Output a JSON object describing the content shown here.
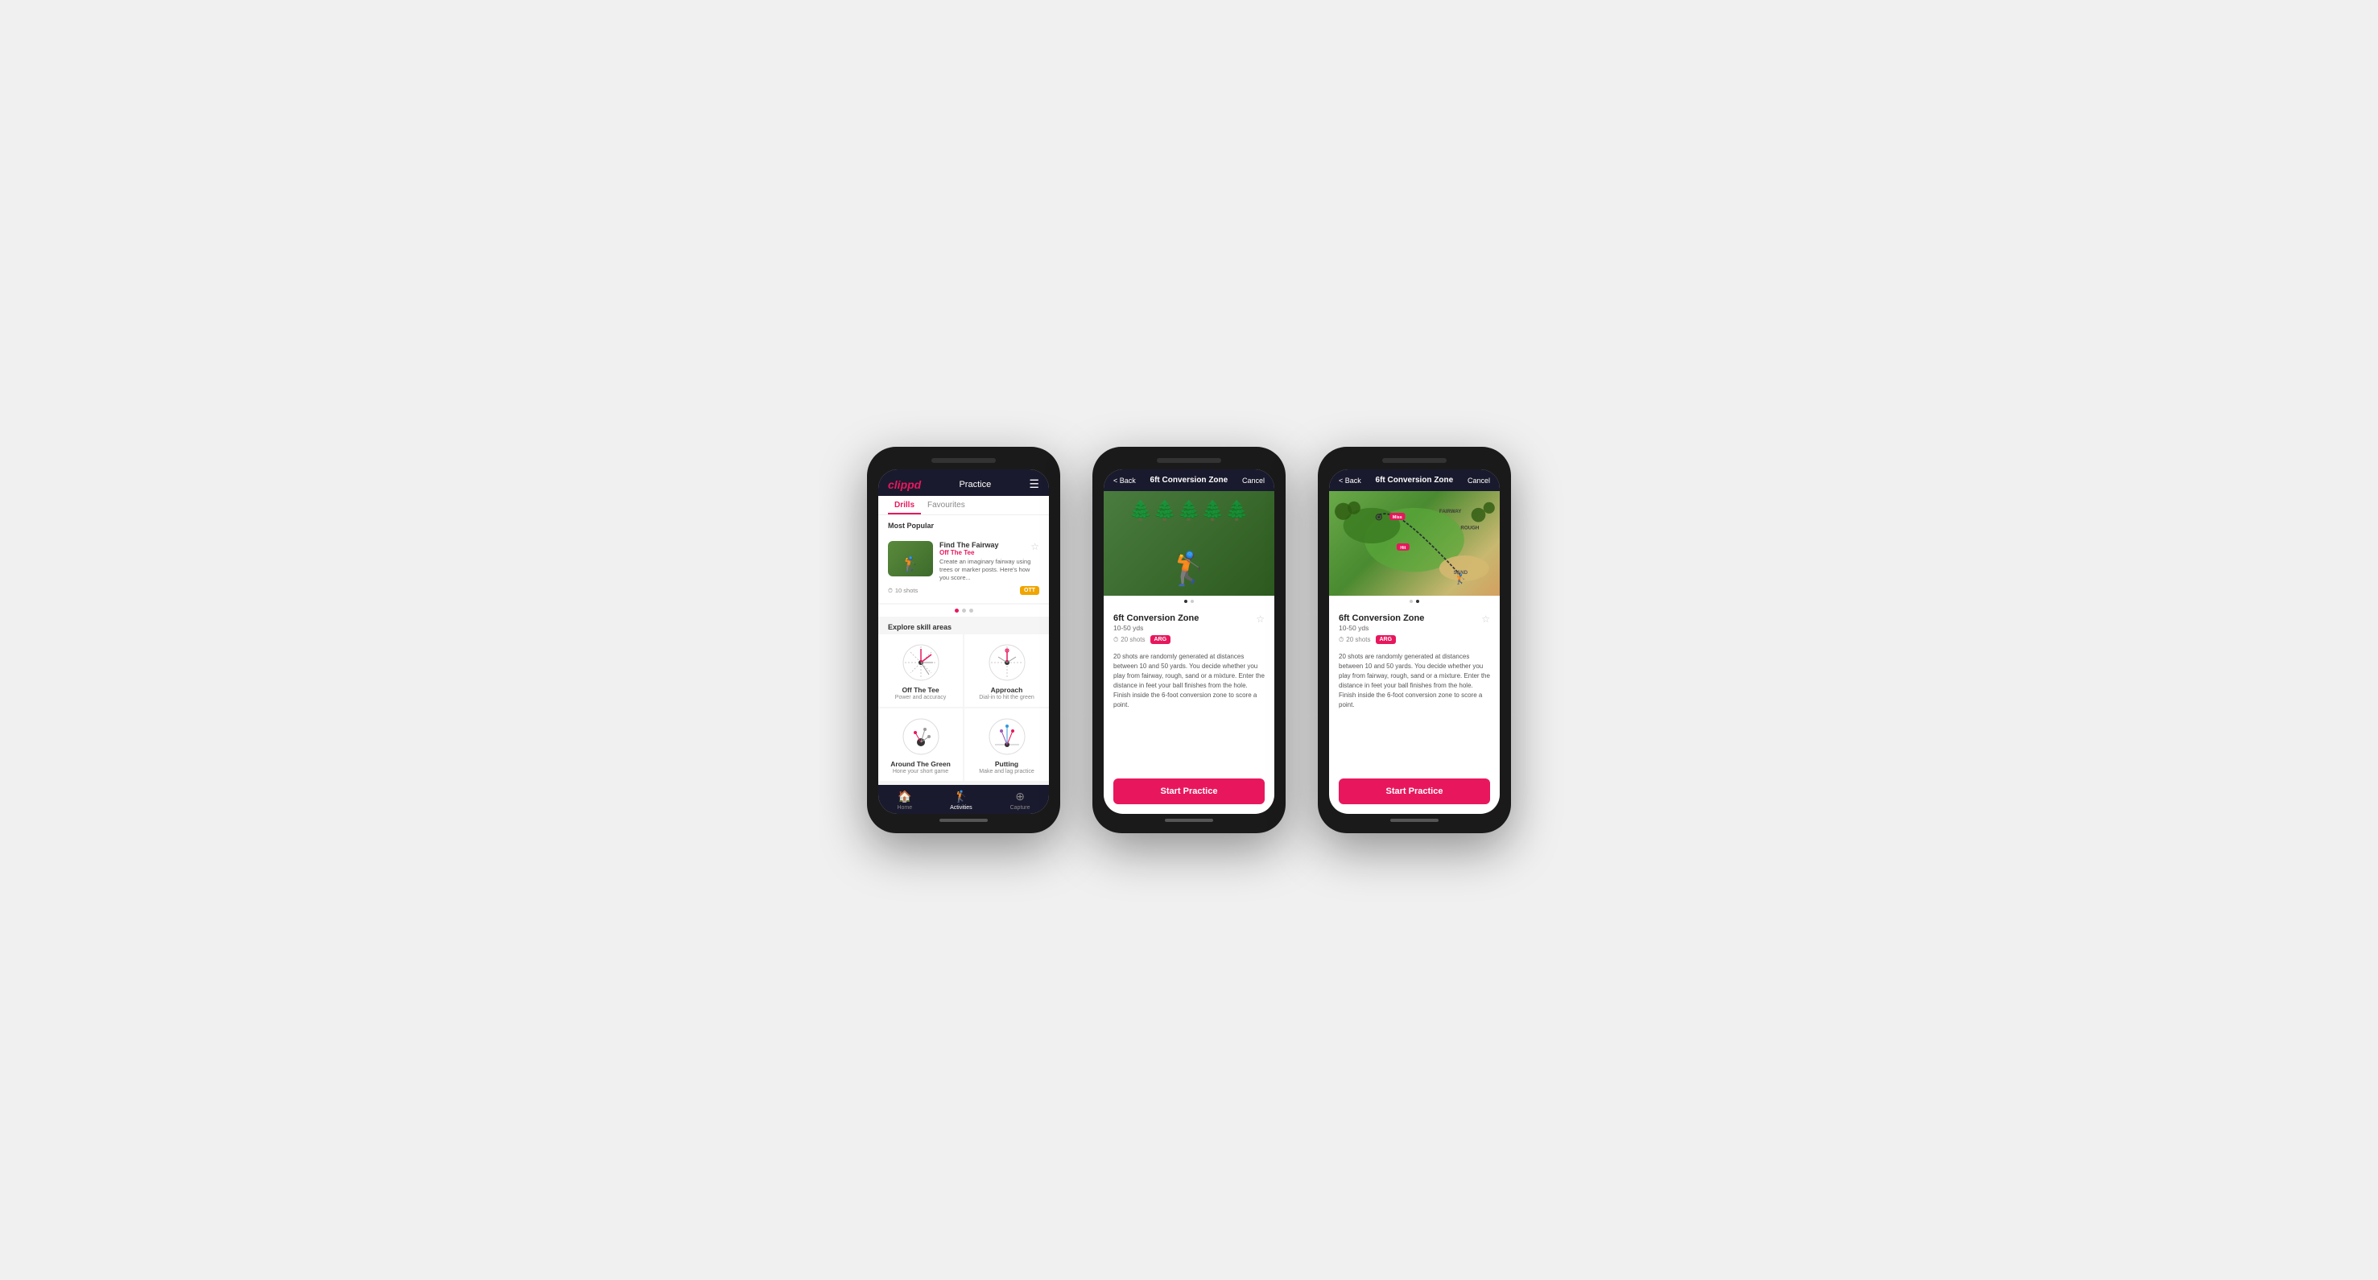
{
  "phones": [
    {
      "id": "phone1",
      "header": {
        "logo": "clippd",
        "title": "Practice",
        "menu_icon": "☰"
      },
      "tabs": [
        {
          "label": "Drills",
          "active": true
        },
        {
          "label": "Favourites",
          "active": false
        }
      ],
      "most_popular_label": "Most Popular",
      "drill_card": {
        "title": "Find The Fairway",
        "subtitle": "Off The Tee",
        "description": "Create an imaginary fairway using trees or marker posts. Here's how you score...",
        "shots": "10 shots",
        "badge": "OTT",
        "star": "☆"
      },
      "explore_label": "Explore skill areas",
      "skill_areas": [
        {
          "name": "Off The Tee",
          "desc": "Power and accuracy"
        },
        {
          "name": "Approach",
          "desc": "Dial-in to hit the green"
        },
        {
          "name": "Around The Green",
          "desc": "Hone your short game"
        },
        {
          "name": "Putting",
          "desc": "Make and lag practice"
        }
      ],
      "nav": [
        {
          "icon": "🏠",
          "label": "Home",
          "active": false
        },
        {
          "icon": "🏌",
          "label": "Activities",
          "active": true
        },
        {
          "icon": "⊕",
          "label": "Capture",
          "active": false
        }
      ]
    },
    {
      "id": "phone2",
      "header": {
        "back_label": "< Back",
        "title": "6ft Conversion Zone",
        "cancel_label": "Cancel"
      },
      "image_type": "photo",
      "drill": {
        "name": "6ft Conversion Zone",
        "range": "10-50 yds",
        "shots": "20 shots",
        "badge": "ARG",
        "star": "☆",
        "description": "20 shots are randomly generated at distances between 10 and 50 yards. You decide whether you play from fairway, rough, sand or a mixture. Enter the distance in feet your ball finishes from the hole. Finish inside the 6-foot conversion zone to score a point."
      },
      "start_button": "Start Practice"
    },
    {
      "id": "phone3",
      "header": {
        "back_label": "< Back",
        "title": "6ft Conversion Zone",
        "cancel_label": "Cancel"
      },
      "image_type": "map",
      "drill": {
        "name": "6ft Conversion Zone",
        "range": "10-50 yds",
        "shots": "20 shots",
        "badge": "ARG",
        "star": "☆",
        "description": "20 shots are randomly generated at distances between 10 and 50 yards. You decide whether you play from fairway, rough, sand or a mixture. Enter the distance in feet your ball finishes from the hole. Finish inside the 6-foot conversion zone to score a point."
      },
      "start_button": "Start Practice"
    }
  ]
}
